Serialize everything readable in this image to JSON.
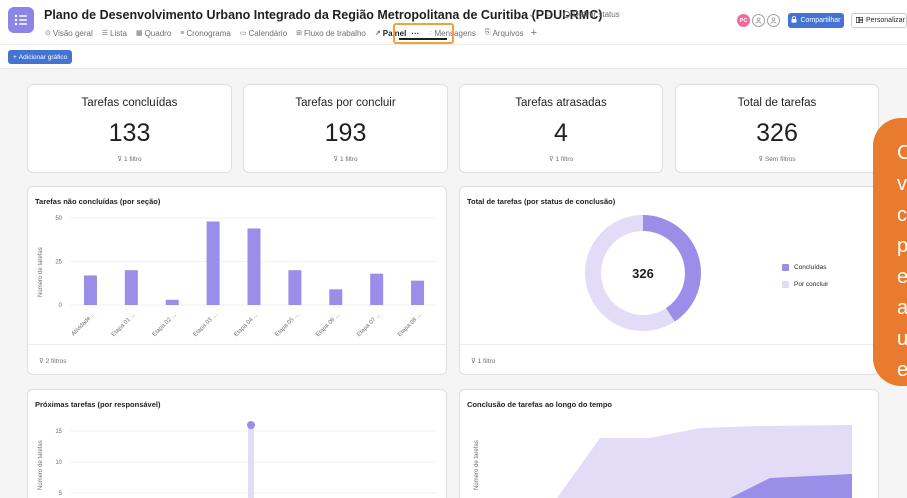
{
  "header": {
    "project_title": "Plano de Desenvolvimento Urbano Integrado da Região Metropolitana de Curitiba (PDUI-RMC)",
    "status_label": "Definir status",
    "share_label": "Compartilhar",
    "customize_label": "Personalizar",
    "avatar_initials": "PC"
  },
  "tabs": [
    {
      "label": "Visão geral",
      "icon": "overview-icon"
    },
    {
      "label": "Lista",
      "icon": "list-icon"
    },
    {
      "label": "Quadro",
      "icon": "board-icon"
    },
    {
      "label": "Cronograma",
      "icon": "timeline-icon"
    },
    {
      "label": "Calendário",
      "icon": "calendar-icon"
    },
    {
      "label": "Fluxo de trabalho",
      "icon": "workflow-icon"
    },
    {
      "label": "Painel",
      "icon": "dashboard-icon",
      "active": true
    },
    {
      "label": "Mensagens",
      "icon": "messages-icon"
    },
    {
      "label": "Arquivos",
      "icon": "files-icon"
    }
  ],
  "toolbar": {
    "add_chart_label": "Adicionar gráfico"
  },
  "kpis": [
    {
      "title": "Tarefas concluídas",
      "value": "133",
      "filter": "1 filtro"
    },
    {
      "title": "Tarefas por concluir",
      "value": "193",
      "filter": "1 filtro"
    },
    {
      "title": "Tarefas atrasadas",
      "value": "4",
      "filter": "1 filtro"
    },
    {
      "title": "Total de tarefas",
      "value": "326",
      "filter": "Sem filtros"
    }
  ],
  "bar_card": {
    "title": "Tarefas não concluídas (por seção)",
    "filter": "2 filtros"
  },
  "donut_card": {
    "title": "Total de tarefas (por status de conclusão)",
    "filter": "1 filtro",
    "center_value": "326"
  },
  "upcoming_card": {
    "title": "Próximas tarefas (por responsável)"
  },
  "timeline_card": {
    "title": "Conclusão de tarefas ao longo do tempo"
  },
  "tooltip_letters": [
    "C",
    "v",
    "c",
    "p",
    "e",
    "a",
    "u",
    "e"
  ],
  "chart_data": [
    {
      "type": "bar",
      "title": "Tarefas não concluídas (por seção)",
      "ylabel": "Número de tarefas",
      "ylim": [
        0,
        50
      ],
      "yticks": [
        0,
        25,
        50
      ],
      "categories": [
        "Atividade...",
        "Etapa 01 ...",
        "Etapa 02 ...",
        "Etapa 03 ...",
        "Etapa 04 ...",
        "Etapa 05 ...",
        "Etapa 06 ...",
        "Etapa 07 ...",
        "Etapa 08 ..."
      ],
      "values": [
        17,
        20,
        3,
        48,
        44,
        20,
        9,
        18,
        14
      ],
      "color": "#9b8ee8"
    },
    {
      "type": "pie",
      "title": "Total de tarefas (por status de conclusão)",
      "total": 326,
      "labels": [
        "Concluídas",
        "Por concluir"
      ],
      "values": [
        133,
        193
      ],
      "colors": [
        "#9b8ee8",
        "#e2dcf7"
      ]
    },
    {
      "type": "bar",
      "title": "Próximas tarefas (por responsável)",
      "ylabel": "Número de tarefas",
      "yticks": [
        5,
        10,
        15
      ],
      "color": "#9b8ee8"
    },
    {
      "type": "area",
      "title": "Conclusão de tarefas ao longo do tempo",
      "ylabel": "Número de tarefas",
      "colors": [
        "#e2dcf7",
        "#9b8ee8"
      ]
    }
  ]
}
